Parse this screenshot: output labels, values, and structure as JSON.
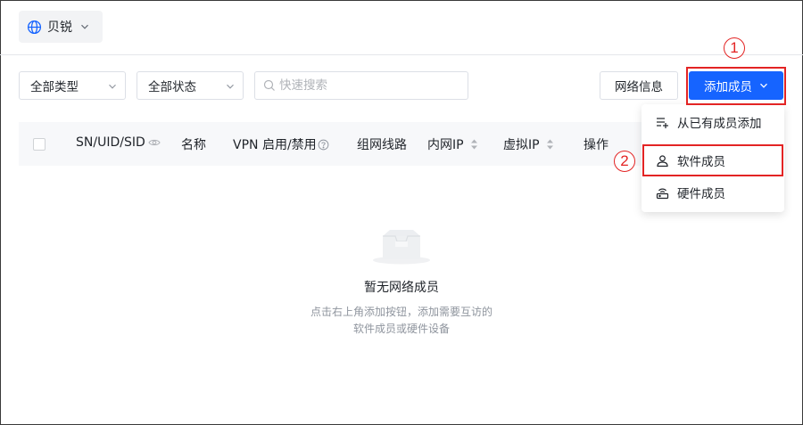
{
  "network_switcher": {
    "label": "贝锐",
    "icon": "globe-icon"
  },
  "filters": {
    "type_select": "全部类型",
    "status_select": "全部状态",
    "search_placeholder": "快速搜索"
  },
  "actions": {
    "network_info_label": "网络信息",
    "add_member_label": "添加成员"
  },
  "table": {
    "columns": [
      "SN/UID/SID",
      "名称",
      "VPN 启用/禁用",
      "组网线路",
      "内网IP",
      "虚拟IP",
      "操作"
    ]
  },
  "empty_state": {
    "title": "暂无网络成员",
    "desc_line1": "点击右上角添加按钮，添加需要互访的",
    "desc_line2": "软件成员或硬件设备"
  },
  "add_menu": {
    "items": [
      {
        "label": "从已有成员添加",
        "icon": "list-add-icon"
      },
      {
        "label": "软件成员",
        "icon": "user-icon"
      },
      {
        "label": "硬件成员",
        "icon": "router-icon"
      }
    ]
  },
  "annotations": {
    "step1": "1",
    "step2": "2"
  },
  "colors": {
    "primary": "#1664ff",
    "highlight": "#e32424",
    "header_bg": "#f7f8fa"
  }
}
